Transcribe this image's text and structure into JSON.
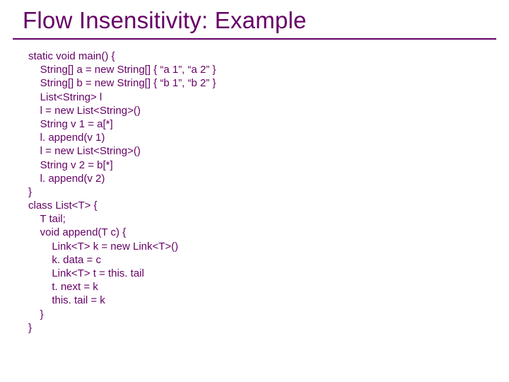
{
  "title": "Flow Insensitivity: Example",
  "code": "static void main() {\n    String[] a = new String[] { “a 1”, “a 2” }\n    String[] b = new String[] { “b 1”, “b 2” }\n    List<String> l\n    l = new List<String>()\n    String v 1 = a[*]\n    l. append(v 1)\n    l = new List<String>()\n    String v 2 = b[*]\n    l. append(v 2)\n}\nclass List<T> {\n    T tail;\n    void append(T c) {\n        Link<T> k = new Link<T>()\n        k. data = c\n        Link<T> t = this. tail\n        t. next = k\n        this. tail = k\n    }\n}"
}
